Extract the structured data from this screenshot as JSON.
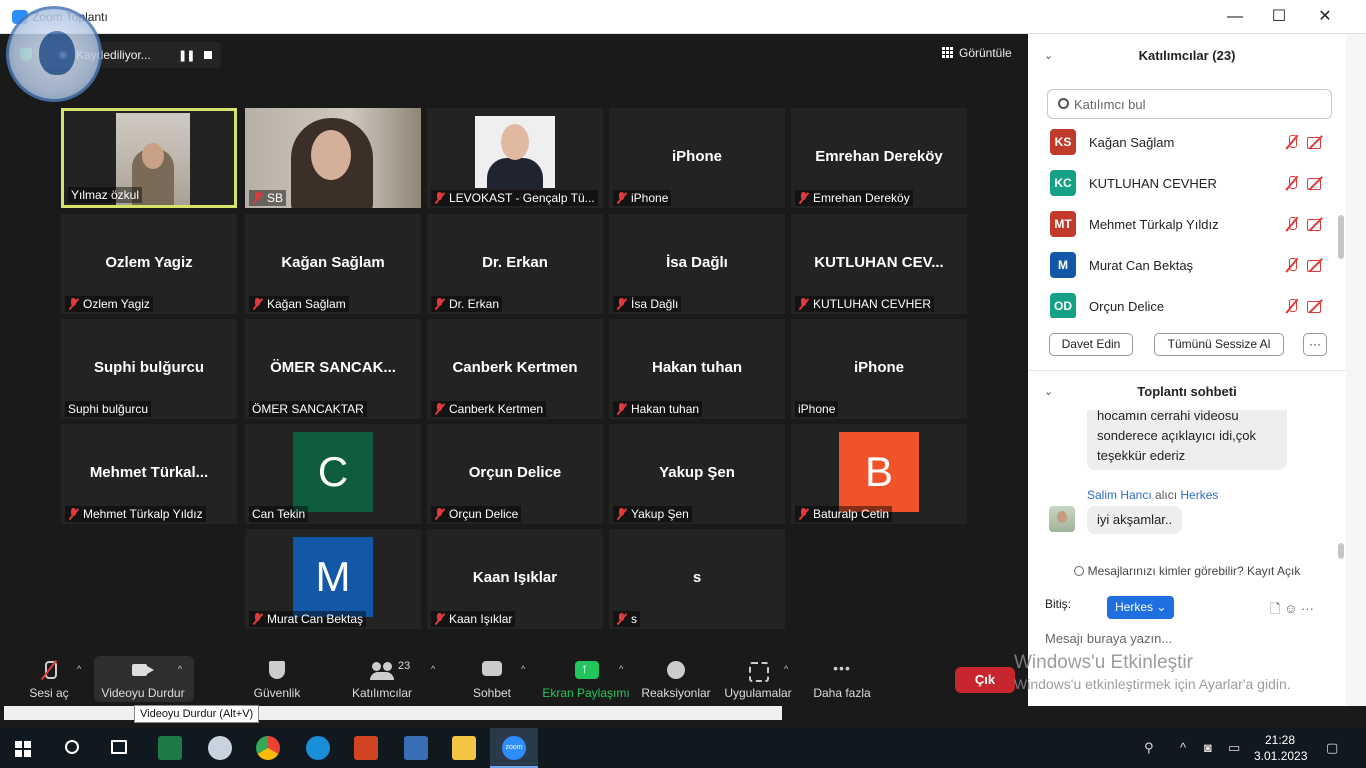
{
  "window": {
    "title": "Zoom Toplantı",
    "minimize": "—",
    "maximize": "☐",
    "close": "✕"
  },
  "recording": {
    "label": "Kaydediliyor...",
    "pause": "❚❚"
  },
  "view": {
    "label": "Görüntüle"
  },
  "tiles": [
    {
      "big": "",
      "label": "Yılmaz özkul",
      "muted": false
    },
    {
      "big": "",
      "label": "SB",
      "muted": true
    },
    {
      "big": "",
      "label": "LEVOKAST - Gençalp Tü...",
      "muted": true
    },
    {
      "big": "iPhone",
      "label": "iPhone",
      "muted": true
    },
    {
      "big": "Emrehan Dereköy",
      "label": "Emrehan Dereköy",
      "muted": true
    },
    {
      "big": "Ozlem Yagiz",
      "label": "Ozlem Yagiz",
      "muted": true
    },
    {
      "big": "Kağan Sağlam",
      "label": "Kağan Sağlam",
      "muted": true
    },
    {
      "big": "Dr. Erkan",
      "label": "Dr. Erkan",
      "muted": true
    },
    {
      "big": "İsa Dağlı",
      "label": "İsa Dağlı",
      "muted": true
    },
    {
      "big": "KUTLUHAN CEV...",
      "label": "KUTLUHAN CEVHER",
      "muted": true
    },
    {
      "big": "Suphi bulğurcu",
      "label": "Suphi bulğurcu",
      "muted": false
    },
    {
      "big": "ÖMER SANCAK...",
      "label": "ÖMER SANCAKTAR",
      "muted": false
    },
    {
      "big": "Canberk Kertmen",
      "label": "Canberk Kertmen",
      "muted": true
    },
    {
      "big": "Hakan tuhan",
      "label": "Hakan tuhan",
      "muted": true
    },
    {
      "big": "iPhone",
      "label": "iPhone",
      "muted": false
    },
    {
      "big": "Mehmet Türkal...",
      "label": "Mehmet Türkalp Yıldız",
      "muted": true
    },
    {
      "big": "C",
      "label": "Can Tekin",
      "muted": false,
      "avatar_color": "#0f5c3f"
    },
    {
      "big": "Orçun Delice",
      "label": "Orçun Delice",
      "muted": true
    },
    {
      "big": "Yakup Şen",
      "label": "Yakup Şen",
      "muted": true
    },
    {
      "big": "B",
      "label": "Baturalp Cetin",
      "muted": true,
      "avatar_color": "#f0532a"
    },
    {
      "big": "M",
      "label": "Murat Can Bektaş",
      "muted": true,
      "avatar_color": "#1358a8"
    },
    {
      "big": "Kaan Işıklar",
      "label": "Kaan Işıklar",
      "muted": true
    },
    {
      "big": "s",
      "label": "s",
      "muted": true
    }
  ],
  "toolbar": {
    "unmute": "Sesi aç",
    "stop_video": "Videoyu Durdur",
    "security": "Güvenlik",
    "participants": "Katılımcılar",
    "participants_count": "23",
    "chat": "Sohbet",
    "share": "Ekran Paylaşımı",
    "reactions": "Reaksiyonlar",
    "apps": "Uygulamalar",
    "more": "Daha fazla",
    "leave": "Çık",
    "tooltip": "Videoyu Durdur (Alt+V)",
    "accent_share": "#22c55e",
    "accent_leave": "#c8262f"
  },
  "participants_panel": {
    "title": "Katılımcılar (23)",
    "search_placeholder": "Katılımcı bul",
    "items": [
      {
        "initials": "KS",
        "name": "Kağan Sağlam",
        "color": "#c0392b"
      },
      {
        "initials": "KC",
        "name": "KUTLUHAN CEVHER",
        "color": "#16a085"
      },
      {
        "initials": "MT",
        "name": "Mehmet Türkalp Yıldız",
        "color": "#c0392b"
      },
      {
        "initials": "M",
        "name": "Murat Can Bektaş",
        "color": "#1358a8"
      },
      {
        "initials": "OD",
        "name": "Orçun Delice",
        "color": "#16a085"
      }
    ],
    "invite": "Davet Edin",
    "mute_all": "Tümünü Sessize Al",
    "more": "···"
  },
  "chat_panel": {
    "title": "Toplantı sohbeti",
    "message1": "hocamın cerrahi videosu sonderece açıklayıcı idi,çok teşekkür ederiz",
    "sender": "Salim Hancı",
    "sender_mid": "alıcı",
    "sender_to": "Herkes",
    "message2": "iyi akşamlar..",
    "visibility": "Mesajlarınızı kimler görebilir? Kayıt Açık",
    "to_label": "Bitiş:",
    "to_value": "Herkes ⌄",
    "input_placeholder": "Mesajı buraya yazın...",
    "tools": "🗋  ☺  ···"
  },
  "activation": {
    "line1": "Windows'u Etkinleştir",
    "line2": "Windows'u etkinleştirmek için Ayarlar'a gidin."
  },
  "taskbar": {
    "time": "21:28",
    "date": "3.01.2023",
    "zoom_label": "zoom"
  }
}
